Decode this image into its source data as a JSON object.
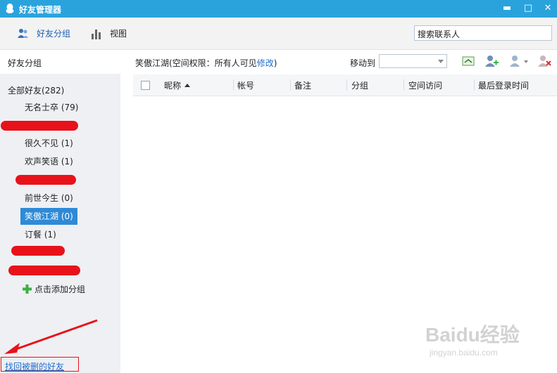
{
  "window": {
    "title": "好友管理器",
    "min": "▬",
    "max": "□",
    "close": "✕"
  },
  "toolbar": {
    "friend_groups": "好友分组",
    "view": "视图",
    "search_placeholder": "搜索联系人"
  },
  "sidebar": {
    "header": "好友分组",
    "all_friends": "全部好友(282)",
    "groups": [
      {
        "label": "无名士卒 (79)"
      },
      {
        "label": "很久不见 (1)"
      },
      {
        "label": "欢声笑语 (1)"
      },
      {
        "label": "前世今生 (0)"
      },
      {
        "label": "笑傲江湖 (0)",
        "selected": true
      },
      {
        "label": "订餐 (1)"
      }
    ],
    "add_group": "点击添加分组",
    "recover": "找回被删的好友"
  },
  "main": {
    "crumb_prefix": "笑傲江湖(空间权限：所有人可见",
    "crumb_link": "修改",
    "crumb_suffix": ")",
    "move_to": "移动到",
    "columns": [
      "昵称",
      "帐号",
      "备注",
      "分组",
      "空间访问",
      "最后登录时间"
    ]
  },
  "watermark": {
    "brand": "Baidu经验",
    "url": "jingyan.baidu.com"
  },
  "colors": {
    "titlebar": "#2aa3dc",
    "selected": "#2f8ad6",
    "redact": "#e8121a",
    "link": "#1f6fd0"
  }
}
